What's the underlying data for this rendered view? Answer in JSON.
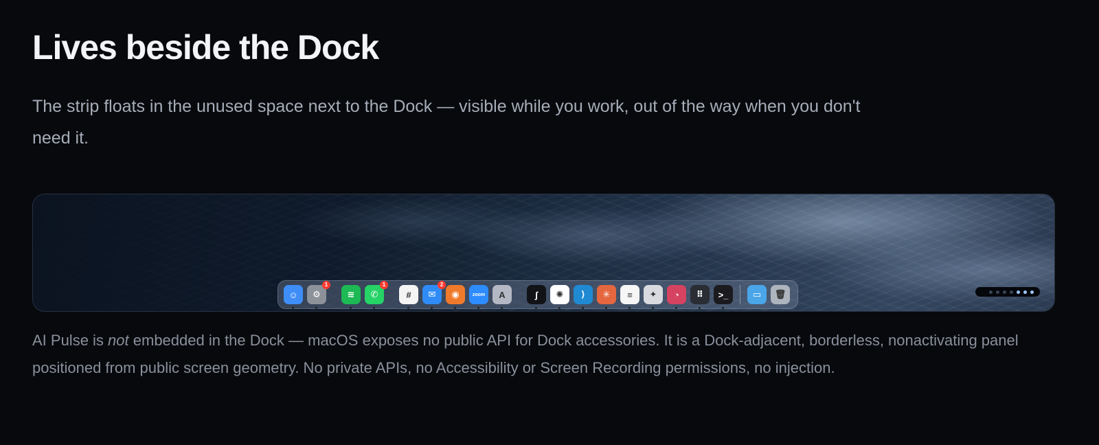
{
  "section": {
    "title": "Lives beside the Dock",
    "lede": "The strip floats in the unused space next to the Dock — visible while you work, out of the way when you don't need it."
  },
  "dock": {
    "apps": [
      {
        "name": "finder-icon",
        "glyph": "☺",
        "bg": "#3f8ef7",
        "badge": ""
      },
      {
        "name": "system-settings-icon",
        "glyph": "⚙",
        "bg": "#8d9199",
        "badge": "1"
      },
      {
        "name": "spotify-icon",
        "glyph": "≋",
        "bg": "#1db954",
        "badge": ""
      },
      {
        "name": "whatsapp-icon",
        "glyph": "✆",
        "bg": "#25d366",
        "badge": "1"
      },
      {
        "name": "slack-icon",
        "glyph": "#",
        "bg": "#f4f4f4",
        "badge": ""
      },
      {
        "name": "mail-icon",
        "glyph": "✉",
        "bg": "#2f8cf6",
        "badge": "2"
      },
      {
        "name": "vpn-icon",
        "glyph": "◉",
        "bg": "#f07a2b",
        "badge": ""
      },
      {
        "name": "zoom-icon",
        "glyph": "zoom",
        "bg": "#2d8cff",
        "badge": ""
      },
      {
        "name": "graphics-app-icon",
        "glyph": "A",
        "bg": "#b4b8c4",
        "badge": ""
      },
      {
        "name": "terminal-app-icon",
        "glyph": "∫",
        "bg": "#111317",
        "badge": ""
      },
      {
        "name": "chatgpt-icon",
        "glyph": "✺",
        "bg": "#ffffff",
        "badge": ""
      },
      {
        "name": "vscode-icon",
        "glyph": "⟩",
        "bg": "#1f8ad2",
        "badge": ""
      },
      {
        "name": "claude-icon",
        "glyph": "✳",
        "bg": "#e5673f",
        "badge": ""
      },
      {
        "name": "notes-icon",
        "glyph": "≡",
        "bg": "#f6f6f6",
        "badge": ""
      },
      {
        "name": "ai-app-icon",
        "glyph": "✦",
        "bg": "#d8dadf",
        "badge": ""
      },
      {
        "name": "speedtest-icon",
        "glyph": "◔",
        "bg": "#d64361",
        "badge": ""
      },
      {
        "name": "launchpad-icon",
        "glyph": "⠿",
        "bg": "#2a2d33",
        "badge": ""
      },
      {
        "name": "terminal-icon",
        "glyph": ">_",
        "bg": "#1b1b1f",
        "badge": ""
      },
      {
        "name": "downloads-folder-icon",
        "glyph": "▭",
        "bg": "#4aa6e8",
        "badge": ""
      },
      {
        "name": "trash-icon",
        "glyph": "🗑",
        "bg": "#aeb4bd",
        "badge": ""
      }
    ]
  },
  "note": {
    "before": "AI Pulse is ",
    "emphasis": "not",
    "after": " embedded in the Dock — macOS exposes no public API for Dock accessories. It is a Dock-adjacent, borderless, nonactivating panel positioned from public screen geometry. No private APIs, no Accessibility or Screen Recording permissions, no injection."
  }
}
